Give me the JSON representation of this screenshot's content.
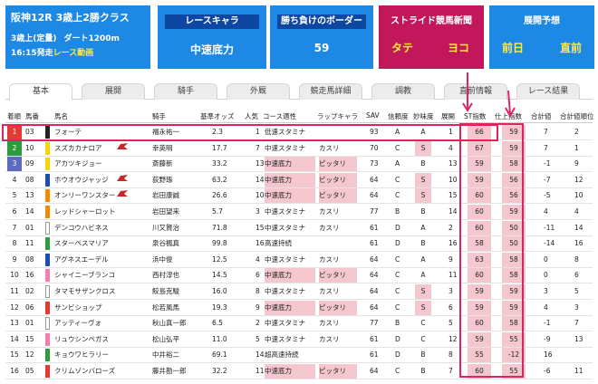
{
  "race": {
    "title": "阪神12R 3歳上2勝クラス",
    "condition": "3歳上(定量)",
    "course": "ダート1200m",
    "post_time": "16:15発走",
    "movie_link": "レース動画"
  },
  "race_chara": {
    "label": "レースキャラ",
    "value": "中速底力"
  },
  "win_border": {
    "label": "勝ち負けのボーダー",
    "value": "59"
  },
  "stride": {
    "label": "ストライド競馬新聞",
    "tate": "タテ",
    "yoko": "ヨコ"
  },
  "tenkai": {
    "label": "展開予想",
    "zenjitsu": "前日",
    "chokuzen": "直前"
  },
  "tabs": [
    "基本",
    "展開",
    "騎手",
    "外厩",
    "競走馬詳細",
    "調教",
    "直前情報",
    "レース結果"
  ],
  "active_tab": "基本",
  "columns": [
    "着順",
    "馬番",
    "馬名",
    "騎手",
    "基準オッズ",
    "人気",
    "コース適性",
    "ラップキャラ",
    "SAV",
    "信頼度",
    "妙味度",
    "展開",
    "ST指数",
    "仕上指数",
    "合計値",
    "合計値順位"
  ],
  "rows": [
    {
      "rank": "1",
      "num": "03",
      "name": "フォーテ",
      "jockey": "福永祐一",
      "odds": "2.3",
      "pop": "1",
      "course": "低速スタミナ",
      "lap": "",
      "sav": "93",
      "trust": "A",
      "value": "A",
      "tenkai": "1",
      "st": "66",
      "shiage": "59",
      "total": "7",
      "total_rank": "2",
      "course_pink": false,
      "lap_pink": false,
      "value_pink": false,
      "jmark": false
    },
    {
      "rank": "2",
      "num": "10",
      "name": "スズカカナロア",
      "jockey": "幸英明",
      "odds": "17.7",
      "pop": "7",
      "course": "中速スタミナ",
      "lap": "カスリ",
      "sav": "70",
      "trust": "C",
      "value": "S",
      "tenkai": "4",
      "st": "67",
      "shiage": "59",
      "total": "7",
      "total_rank": "1",
      "course_pink": false,
      "lap_pink": false,
      "value_pink": true,
      "jmark": true
    },
    {
      "rank": "3",
      "num": "09",
      "name": "アカツキジョー",
      "jockey": "斎藤新",
      "odds": "33.2",
      "pop": "13",
      "course": "中速底力",
      "lap": "ピッタリ",
      "sav": "73",
      "trust": "A",
      "value": "B",
      "tenkai": "13",
      "st": "59",
      "shiage": "58",
      "total": "-1",
      "total_rank": "9",
      "course_pink": true,
      "lap_pink": true,
      "value_pink": false,
      "jmark": false
    },
    {
      "rank": "4",
      "num": "08",
      "name": "ホウオウジャッジ",
      "jockey": "荻野琢",
      "odds": "63.2",
      "pop": "14",
      "course": "中速底力",
      "lap": "ピッタリ",
      "sav": "64",
      "trust": "C",
      "value": "S",
      "tenkai": "10",
      "st": "59",
      "shiage": "56",
      "total": "-7",
      "total_rank": "12",
      "course_pink": true,
      "lap_pink": true,
      "value_pink": true,
      "jmark": true
    },
    {
      "rank": "5",
      "num": "13",
      "name": "オンリーワンスター",
      "jockey": "岩田康誠",
      "odds": "26.6",
      "pop": "10",
      "course": "中速底力",
      "lap": "ピッタリ",
      "sav": "64",
      "trust": "C",
      "value": "S",
      "tenkai": "15",
      "st": "60",
      "shiage": "56",
      "total": "-5",
      "total_rank": "10",
      "course_pink": true,
      "lap_pink": true,
      "value_pink": true,
      "jmark": true
    },
    {
      "rank": "6",
      "num": "14",
      "name": "レッドシャーロット",
      "jockey": "岩田望来",
      "odds": "5.7",
      "pop": "3",
      "course": "中速スタミナ",
      "lap": "カスリ",
      "sav": "77",
      "trust": "B",
      "value": "B",
      "tenkai": "14",
      "st": "60",
      "shiage": "59",
      "total": "4",
      "total_rank": "4",
      "course_pink": false,
      "lap_pink": false,
      "value_pink": false,
      "jmark": false
    },
    {
      "rank": "7",
      "num": "01",
      "name": "デンコウハビネス",
      "jockey": "川又賢治",
      "odds": "71.8",
      "pop": "15",
      "course": "中速スタミナ",
      "lap": "カスリ",
      "sav": "61",
      "trust": "D",
      "value": "A",
      "tenkai": "2",
      "st": "60",
      "shiage": "50",
      "total": "-11",
      "total_rank": "14",
      "course_pink": false,
      "lap_pink": false,
      "value_pink": false,
      "jmark": false
    },
    {
      "rank": "8",
      "num": "11",
      "name": "スターペスマリア",
      "jockey": "泉谷楓真",
      "odds": "99.8",
      "pop": "16",
      "course": "高速持続",
      "lap": "",
      "sav": "61",
      "trust": "D",
      "value": "B",
      "tenkai": "16",
      "st": "58",
      "shiage": "50",
      "total": "-14",
      "total_rank": "16",
      "course_pink": false,
      "lap_pink": false,
      "value_pink": false,
      "jmark": false
    },
    {
      "rank": "9",
      "num": "08",
      "name": "アグネスエーデル",
      "jockey": "浜中俊",
      "odds": "12.5",
      "pop": "4",
      "course": "中速スタミナ",
      "lap": "カスリ",
      "sav": "64",
      "trust": "C",
      "value": "A",
      "tenkai": "9",
      "st": "63",
      "shiage": "58",
      "total": "0",
      "total_rank": "8",
      "course_pink": false,
      "lap_pink": false,
      "value_pink": false,
      "jmark": false
    },
    {
      "rank": "10",
      "num": "16",
      "name": "シャイニーブランコ",
      "jockey": "西村淳也",
      "odds": "14.5",
      "pop": "6",
      "course": "中速底力",
      "lap": "ピッタリ",
      "sav": "64",
      "trust": "C",
      "value": "A",
      "tenkai": "11",
      "st": "60",
      "shiage": "58",
      "total": "0",
      "total_rank": "6",
      "course_pink": true,
      "lap_pink": true,
      "value_pink": false,
      "jmark": false
    },
    {
      "rank": "11",
      "num": "02",
      "name": "タマモサザンクロス",
      "jockey": "鮫島克駿",
      "odds": "16.0",
      "pop": "8",
      "course": "中速スタミナ",
      "lap": "カスリ",
      "sav": "64",
      "trust": "C",
      "value": "S",
      "tenkai": "3",
      "st": "59",
      "shiage": "59",
      "total": "3",
      "total_rank": "5",
      "course_pink": false,
      "lap_pink": false,
      "value_pink": true,
      "jmark": false
    },
    {
      "rank": "12",
      "num": "06",
      "name": "サンビショップ",
      "jockey": "松若風馬",
      "odds": "19.3",
      "pop": "9",
      "course": "中速底力",
      "lap": "ピッタリ",
      "sav": "64",
      "trust": "C",
      "value": "S",
      "tenkai": "6",
      "st": "59",
      "shiage": "59",
      "total": "4",
      "total_rank": "3",
      "course_pink": true,
      "lap_pink": true,
      "value_pink": true,
      "jmark": false
    },
    {
      "rank": "13",
      "num": "01",
      "name": "アッティーヴォ",
      "jockey": "秋山真一郎",
      "odds": "6.5",
      "pop": "2",
      "course": "中速スタミナ",
      "lap": "カスリ",
      "sav": "77",
      "trust": "B",
      "value": "C",
      "tenkai": "5",
      "st": "60",
      "shiage": "58",
      "total": "-1",
      "total_rank": "7",
      "course_pink": false,
      "lap_pink": false,
      "value_pink": false,
      "jmark": false
    },
    {
      "rank": "14",
      "num": "15",
      "name": "リュウシンペガス",
      "jockey": "松山弘平",
      "odds": "11.0",
      "pop": "5",
      "course": "中速スタミナ",
      "lap": "カスリ",
      "sav": "61",
      "trust": "D",
      "value": "C",
      "tenkai": "12",
      "st": "59",
      "shiage": "55",
      "total": "-9",
      "total_rank": "13",
      "course_pink": false,
      "lap_pink": false,
      "value_pink": false,
      "jmark": false
    },
    {
      "rank": "15",
      "num": "12",
      "name": "キョウワヒラリー",
      "jockey": "中井裕二",
      "odds": "69.1",
      "pop": "14",
      "course": "超高速持続",
      "lap": "",
      "sav": "61",
      "trust": "D",
      "value": "B",
      "tenkai": "8",
      "st": "55",
      "shiage": "-12",
      "total": "16",
      "total_rank": "",
      "course_pink": false,
      "lap_pink": false,
      "value_pink": false,
      "jmark": false
    },
    {
      "rank": "16",
      "num": "05",
      "name": "クリムゾンバローズ",
      "jockey": "藤井勘一郎",
      "odds": "32.2",
      "pop": "11",
      "course": "中速底力",
      "lap": "ピッタリ",
      "sav": "64",
      "trust": "C",
      "value": "B",
      "tenkai": "7",
      "st": "60",
      "shiage": "55",
      "total": "-6",
      "total_rank": "11",
      "course_pink": true,
      "lap_pink": true,
      "value_pink": false,
      "jmark": false
    }
  ],
  "colors": {
    "race_blue": "#1e88e5",
    "header_navy": "#0d47a1",
    "stride_magenta": "#c2185b",
    "accent_yellow": "#ffeb3b",
    "highlight_red": "#e0245e",
    "pink_cell": "#f4c7cf",
    "waku_colors": [
      "#ffffff",
      "#222222",
      "#e53935",
      "#1e4fa8",
      "#f2d600",
      "#2e9b3c",
      "#f08a00",
      "#ef7fb0"
    ]
  }
}
